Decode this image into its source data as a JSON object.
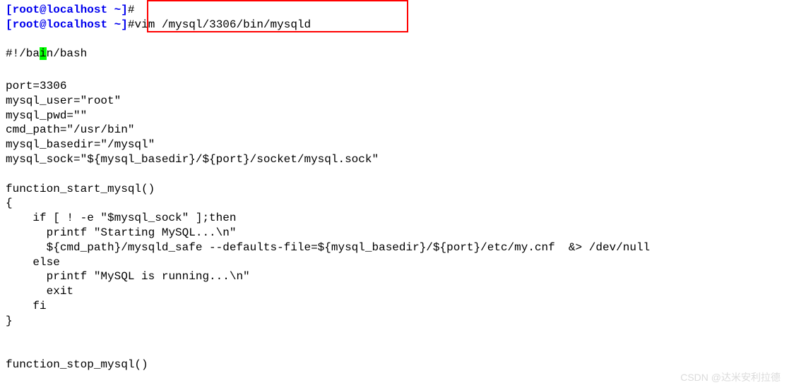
{
  "prompt": {
    "line0_prefix": "[",
    "line0_user": "root",
    "line0_at": "@",
    "line0_host": "localhost",
    "line0_space": " ",
    "line0_tilde": "~",
    "line0_suffix": "]",
    "line0_hash": "#",
    "line1_prefix": "[",
    "line1_user": "root",
    "line1_at": "@",
    "line1_host": "localhost",
    "line1_space": " ",
    "line1_tilde": "~",
    "line1_suffix": "]",
    "line1_hash": "#",
    "line1_cmd": "vim /mysql/3306/bin/mysqld"
  },
  "script": {
    "shebang_pre": "#!/ba",
    "shebang_cursor": "i",
    "shebang_post": "n/bash",
    "blank1": "",
    "l1": "port=3306",
    "l2": "mysql_user=\"root\"",
    "l3": "mysql_pwd=\"\"",
    "l4": "cmd_path=\"/usr/bin\"",
    "l5": "mysql_basedir=\"/mysql\"",
    "l6": "mysql_sock=\"${mysql_basedir}/${port}/socket/mysql.sock\"",
    "blank2": "",
    "l7": "function_start_mysql()",
    "l8": "{",
    "l9": "    if [ ! -e \"$mysql_sock\" ];then",
    "l10": "      printf \"Starting MySQL...\\n\"",
    "l11": "      ${cmd_path}/mysqld_safe --defaults-file=${mysql_basedir}/${port}/etc/my.cnf  &> /dev/null",
    "l12": "    else",
    "l13": "      printf \"MySQL is running...\\n\"",
    "l14": "      exit",
    "l15": "    fi",
    "l16": "}",
    "blank3": "",
    "blank4": "",
    "l17": "function_stop_mysql()"
  },
  "watermark": "CSDN @达米安利拉德"
}
